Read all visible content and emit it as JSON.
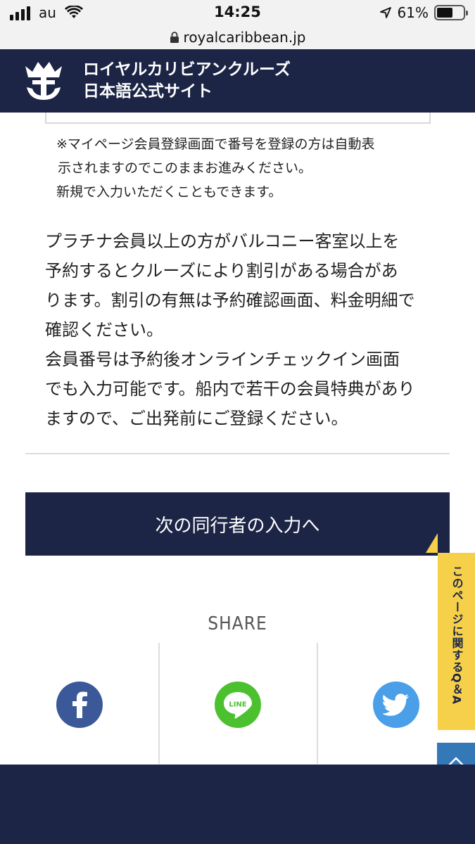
{
  "status_bar": {
    "carrier": "au",
    "time": "14:25",
    "battery_percent": "61%",
    "battery_level": 0.61,
    "icons": [
      "signal-icon",
      "wifi-icon",
      "location-arrow-icon",
      "battery-icon"
    ]
  },
  "url_bar": {
    "url": "royalcaribbean.jp",
    "icon": "lock-icon"
  },
  "header": {
    "title_line1": "ロイヤルカリビアンクルーズ",
    "title_line2": "日本語公式サイト",
    "logo": "crown-anchor-logo",
    "background": "#1c2546"
  },
  "notice": {
    "line1": "※マイページ会員登録画面で番号を登録の方は自動表",
    "line2": "示されますのでこのままお進みください。",
    "line3": "新規で入力いただくこともできます。"
  },
  "body": {
    "lines": [
      "プラチナ会員以上の方がバルコニー客室以上を",
      "予約するとクルーズにより割引がある場合があ",
      "ります。割引の有無は予約確認画面、料金明細で",
      "確認ください。",
      "会員番号は予約後オンラインチェックイン画面",
      "でも入力可能です。船内で若干の会員特典があり",
      "ますので、ご出発前にご登録ください。"
    ]
  },
  "next_button": {
    "label": "次の同行者の入力へ"
  },
  "share": {
    "title": "SHARE",
    "items": [
      {
        "name": "facebook",
        "icon": "facebook-icon",
        "color": "#3b5998"
      },
      {
        "name": "line",
        "icon": "line-icon",
        "color": "#4cc12f",
        "label": "LINE"
      },
      {
        "name": "twitter",
        "icon": "twitter-icon",
        "color": "#4a9fe8"
      }
    ]
  },
  "side_tab": {
    "label": "このページに関するQ＆A",
    "color": "#f7d04a"
  },
  "back_to_top": {
    "icon": "chevron-up-icon",
    "color": "#3578b8"
  },
  "colors": {
    "navy": "#1c2546",
    "text": "#222222",
    "divider": "#dddddd"
  }
}
